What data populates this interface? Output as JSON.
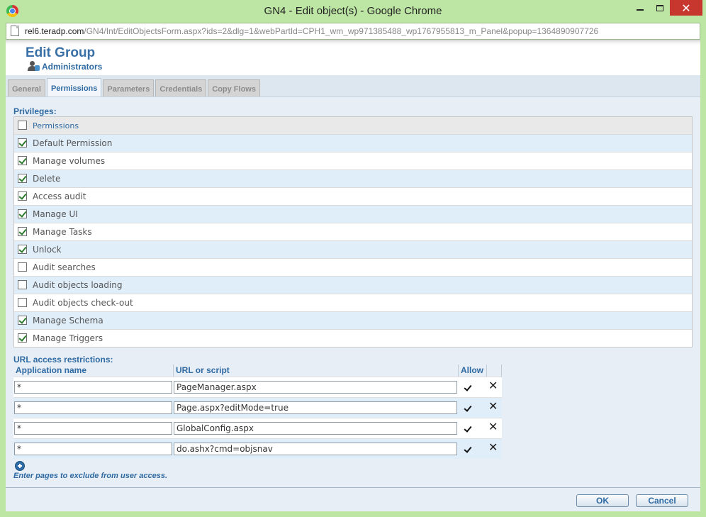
{
  "window": {
    "title": "GN4 - Edit object(s) - Google Chrome",
    "url_host": "rel6.teradp.com",
    "url_path": "/GN4/Int/EditObjectsForm.aspx?ids=2&dlg=1&webPartId=CPH1_wm_wp971385488_wp1767955813_m_Panel&popup=1364890907726"
  },
  "header": {
    "title": "Edit Group",
    "subtitle": "Administrators"
  },
  "tabs": [
    {
      "label": "General",
      "active": false
    },
    {
      "label": "Permissions",
      "active": true
    },
    {
      "label": "Parameters",
      "active": false
    },
    {
      "label": "Credentials",
      "active": false
    },
    {
      "label": "Copy Flows",
      "active": false
    }
  ],
  "privileges": {
    "label": "Privileges:",
    "header": "Permissions",
    "items": [
      {
        "label": "Default Permission",
        "checked": true
      },
      {
        "label": "Manage volumes",
        "checked": true
      },
      {
        "label": "Delete",
        "checked": true
      },
      {
        "label": "Access audit",
        "checked": true
      },
      {
        "label": "Manage UI",
        "checked": true
      },
      {
        "label": "Manage Tasks",
        "checked": true
      },
      {
        "label": "Unlock",
        "checked": true
      },
      {
        "label": "Audit searches",
        "checked": false
      },
      {
        "label": "Audit objects loading",
        "checked": false
      },
      {
        "label": "Audit objects check-out",
        "checked": false
      },
      {
        "label": "Manage Schema",
        "checked": true
      },
      {
        "label": "Manage Triggers",
        "checked": true
      }
    ]
  },
  "url_restrictions": {
    "label": "URL access restrictions:",
    "columns": [
      "Application name",
      "URL or script",
      "Allow"
    ],
    "rows": [
      {
        "app": "*",
        "url": "PageManager.aspx",
        "allow": true
      },
      {
        "app": "*",
        "url": "Page.aspx?editMode=true",
        "allow": true
      },
      {
        "app": "*",
        "url": "GlobalConfig.aspx",
        "allow": true
      },
      {
        "app": "*",
        "url": "do.ashx?cmd=objsnav",
        "allow": true
      }
    ],
    "hint": "Enter pages to exclude from user access."
  },
  "footer": {
    "ok_label": "OK",
    "cancel_label": "Cancel"
  },
  "icons": {
    "app": "chrome-icon",
    "add": "add-circle-icon",
    "delete": "close-x-icon"
  }
}
